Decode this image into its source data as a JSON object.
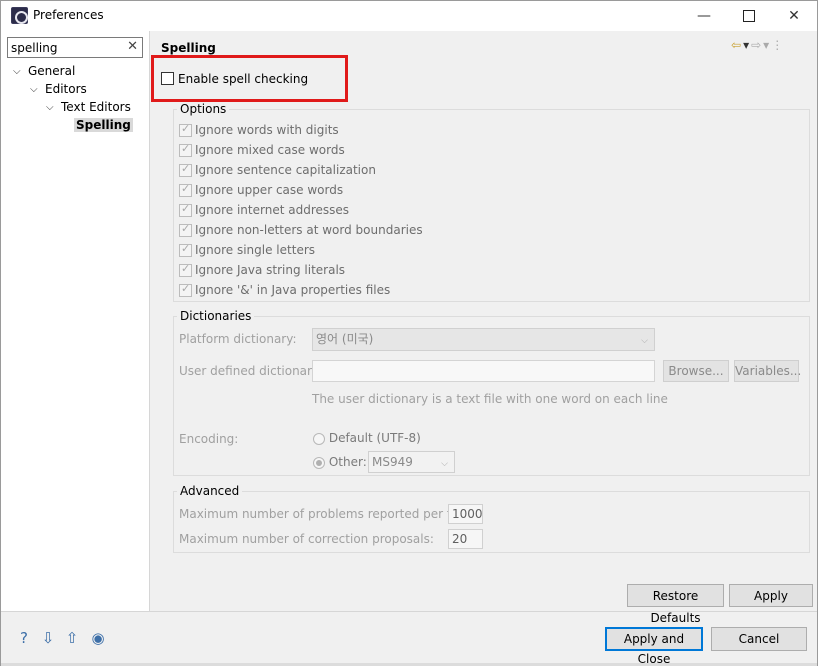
{
  "window": {
    "title": "Preferences",
    "minimize": "—",
    "close": "✕"
  },
  "sidebar": {
    "filter_value": "spelling",
    "filter_clear": "✕",
    "tree": [
      {
        "label": "General",
        "expanded": true
      },
      {
        "label": "Editors",
        "expanded": true
      },
      {
        "label": "Text Editors",
        "expanded": true
      },
      {
        "label": "Spelling",
        "selected": true
      }
    ],
    "expand_glyph": "⌵"
  },
  "page": {
    "title": "Spelling",
    "enable_label": "Enable spell checking",
    "enable_checked": false
  },
  "options": {
    "title": "Options",
    "items": [
      "Ignore words with digits",
      "Ignore mixed case words",
      "Ignore sentence capitalization",
      "Ignore upper case words",
      "Ignore internet addresses",
      "Ignore non-letters at word boundaries",
      "Ignore single letters",
      "Ignore Java string literals",
      "Ignore '&' in Java properties files"
    ]
  },
  "dictionaries": {
    "title": "Dictionaries",
    "platform_label": "Platform dictionary:",
    "platform_value": "영어 (미국)",
    "user_label": "User defined dictionary:",
    "user_value": "",
    "browse": "Browse...",
    "variables": "Variables...",
    "hint": "The user dictionary is a text file with one word on each line",
    "encoding_label": "Encoding:",
    "default_encoding": "Default (UTF-8)",
    "other_label": "Other:",
    "other_value": "MS949"
  },
  "advanced": {
    "title": "Advanced",
    "max_problems_label": "Maximum number of problems reported per file:",
    "max_problems_value": "1000",
    "max_proposals_label": "Maximum number of correction proposals:",
    "max_proposals_value": "20"
  },
  "buttons": {
    "restore_defaults": "Restore Defaults",
    "apply": "Apply",
    "apply_and_close": "Apply and Close",
    "cancel": "Cancel"
  },
  "footer_icons": [
    "help-icon",
    "import-icon",
    "export-icon",
    "record-icon"
  ],
  "colors": {
    "highlight": "#e01a1a",
    "default_button_border": "#0078d7"
  }
}
